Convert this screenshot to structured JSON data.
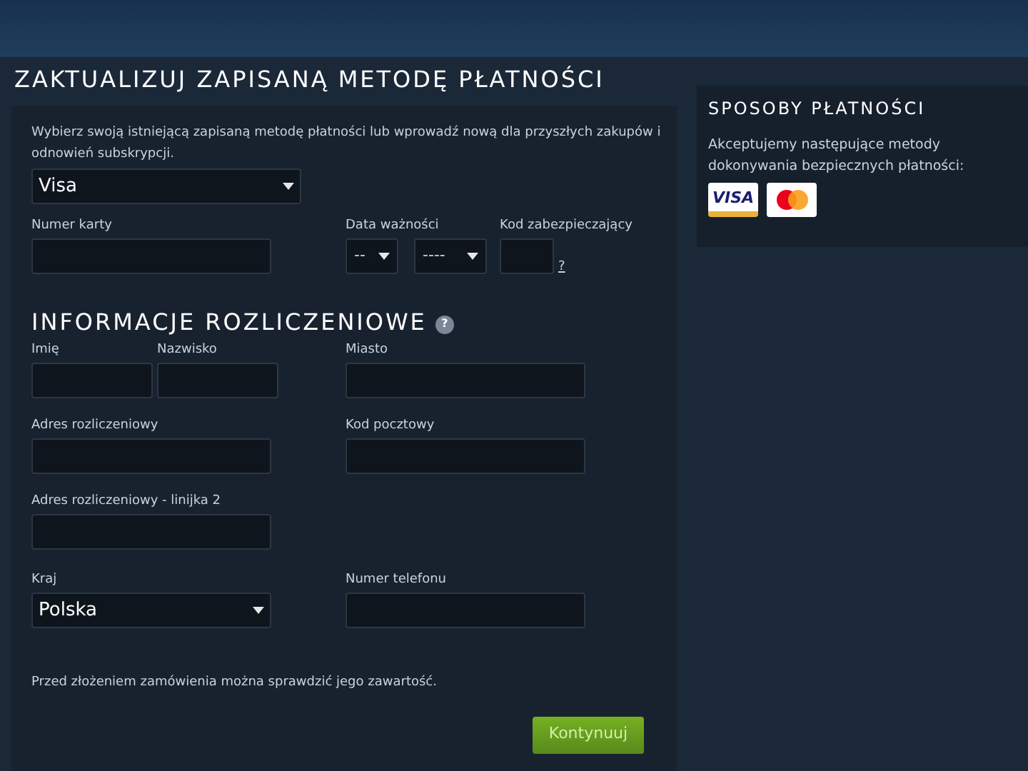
{
  "title": "ZAKTUALIZUJ ZAPISANĄ METODĘ PŁATNOŚCI",
  "payment": {
    "intro": "Wybierz swoją istniejącą zapisaną metodę płatności lub wprowadź nową dla przyszłych zakupów i odnowień subskrypcji.",
    "method": "Visa",
    "card_number_label": "Numer karty",
    "expiry_label": "Data ważności",
    "expiry_month": "--",
    "expiry_year": "----",
    "cvv_label": "Kod zabezpieczający",
    "cvv_help": "?"
  },
  "billing": {
    "title": "INFORMACJE ROZLICZENIOWE",
    "help": "?",
    "fields": [
      {
        "label": "Imię",
        "kind": "half"
      },
      {
        "label": "Nazwisko",
        "kind": "half"
      },
      {
        "label": "Miasto",
        "kind": "text"
      },
      {
        "label": "Adres rozliczeniowy",
        "kind": "text"
      },
      {
        "label": "Kod pocztowy",
        "kind": "text"
      },
      {
        "label": "Adres rozliczeniowy - linijka 2",
        "kind": "text"
      },
      {
        "label": "Kraj",
        "kind": "select",
        "value": "Polska"
      },
      {
        "label": "Numer telefonu",
        "kind": "text"
      }
    ],
    "note": "Przed złożeniem zamówienia można sprawdzić jego zawartość.",
    "continue": "Kontynuuj"
  },
  "sidebar": {
    "title": "SPOSOBY PŁATNOŚCI",
    "text": "Akceptujemy następujące metody dokonywania bezpiecznych płatności:",
    "cards": [
      {
        "kind": "visa",
        "label": "VISA"
      },
      {
        "kind": "mastercard"
      }
    ]
  }
}
